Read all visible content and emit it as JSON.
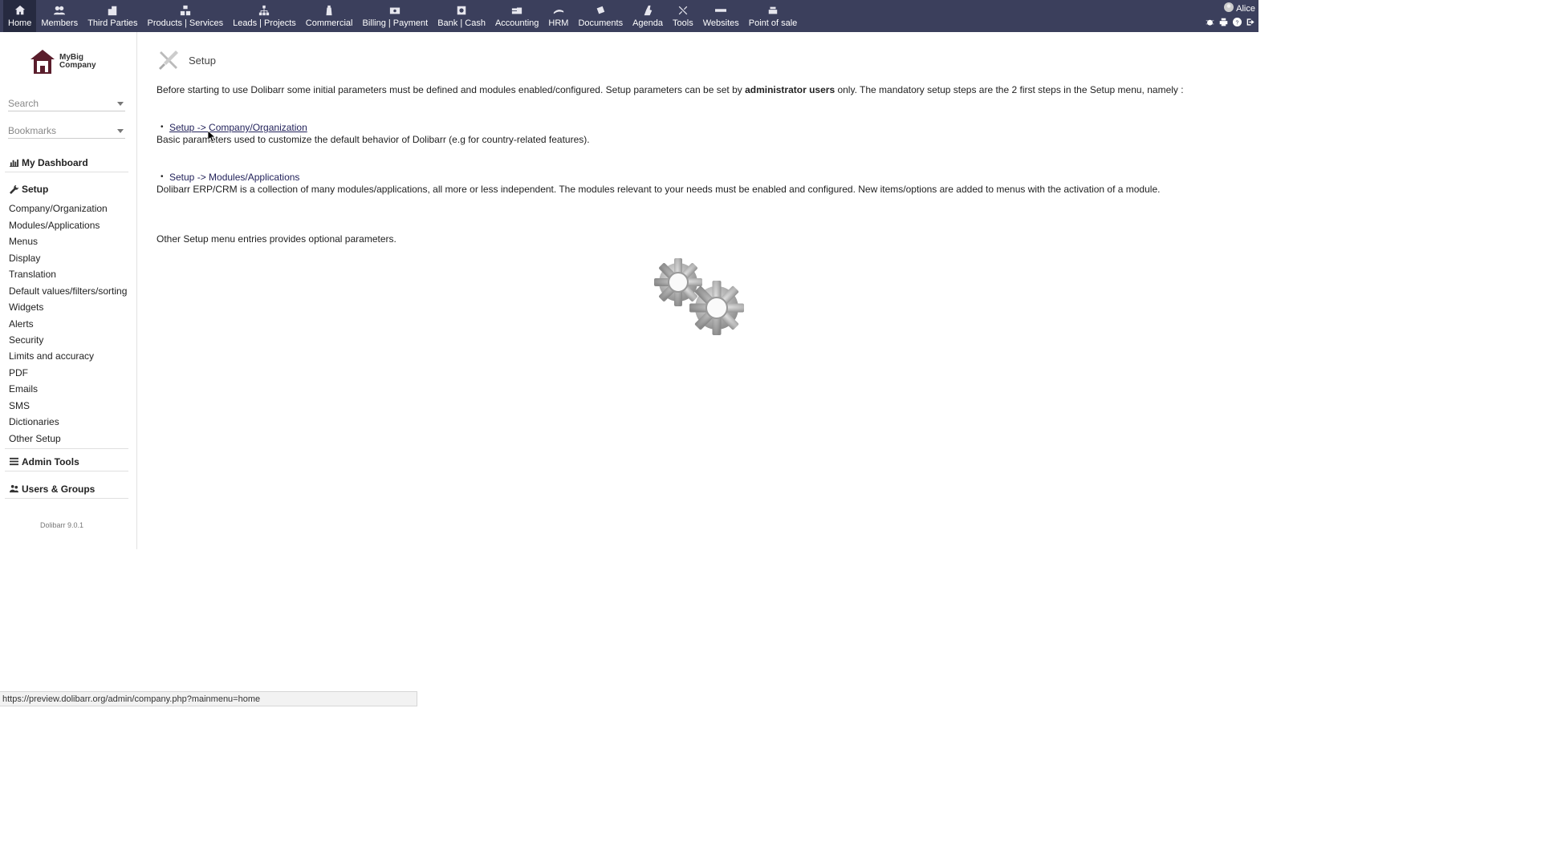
{
  "topmenu": [
    {
      "label": "Home",
      "icon": "home-icon",
      "active": true
    },
    {
      "label": "Members",
      "icon": "members-icon"
    },
    {
      "label": "Third Parties",
      "icon": "building-icon"
    },
    {
      "label": "Products | Services",
      "icon": "cubes-icon"
    },
    {
      "label": "Leads | Projects",
      "icon": "sitemap-icon"
    },
    {
      "label": "Commercial",
      "icon": "suitcase-icon"
    },
    {
      "label": "Billing | Payment",
      "icon": "money-icon"
    },
    {
      "label": "Bank | Cash",
      "icon": "bank-icon"
    },
    {
      "label": "Accounting",
      "icon": "coins-icon"
    },
    {
      "label": "HRM",
      "icon": "hrm-icon"
    },
    {
      "label": "Documents",
      "icon": "documents-icon"
    },
    {
      "label": "Agenda",
      "icon": "agenda-icon"
    },
    {
      "label": "Tools",
      "icon": "tools-icon"
    },
    {
      "label": "Websites",
      "icon": "websites-icon"
    },
    {
      "label": "Point of sale",
      "icon": "cash-register-icon"
    }
  ],
  "user": {
    "name": "Alice"
  },
  "company": {
    "line1": "MyBig",
    "line2": "Company"
  },
  "left": {
    "search_placeholder": "Search",
    "bookmarks_label": "Bookmarks",
    "dashboard": "My Dashboard",
    "setup": "Setup",
    "setup_items": [
      "Company/Organization",
      "Modules/Applications",
      "Menus",
      "Display",
      "Translation",
      "Default values/filters/sorting",
      "Widgets",
      "Alerts",
      "Security",
      "Limits and accuracy",
      "PDF",
      "Emails",
      "SMS",
      "Dictionaries",
      "Other Setup"
    ],
    "admin_tools": "Admin Tools",
    "users_groups": "Users & Groups",
    "version": "Dolibarr 9.0.1"
  },
  "main": {
    "title": "Setup",
    "intro_before": "Before starting to use Dolibarr some initial parameters must be defined and modules enabled/configured. Setup parameters can be set by ",
    "intro_bold": "administrator users",
    "intro_after": " only. The mandatory setup steps are the 2 first steps in the Setup menu, namely :",
    "step1_link": "Setup -> Company/Organization",
    "step1_desc": "Basic parameters used to customize the default behavior of Dolibarr (e.g for country-related features).",
    "step2_link": "Setup -> Modules/Applications",
    "step2_desc": "Dolibarr ERP/CRM is a collection of many modules/applications, all more or less independent. The modules relevant to your needs must be enabled and configured. New items/options are added to menus with the activation of a module.",
    "other": "Other Setup menu entries provides optional parameters."
  },
  "statusbar": {
    "url": "https://preview.dolibarr.org/admin/company.php?mainmenu=home"
  },
  "colors": {
    "topbar": "#3b3f5c",
    "link": "#23235b"
  }
}
